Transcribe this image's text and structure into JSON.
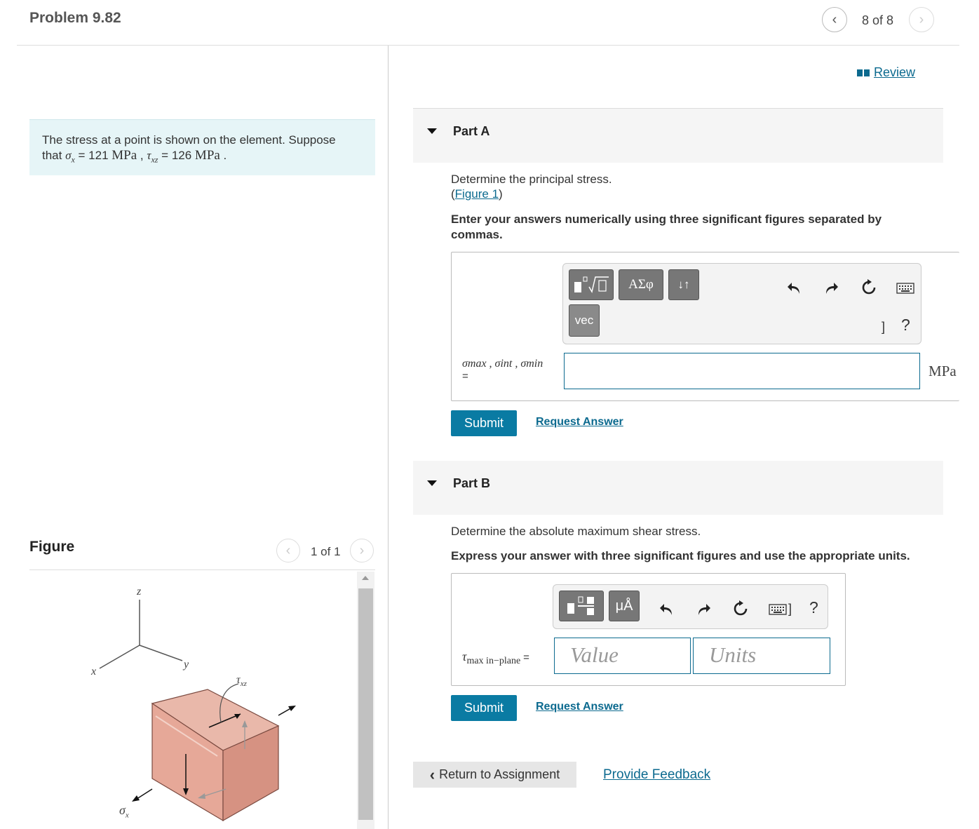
{
  "header": {
    "title": "Problem 9.82",
    "pager": "8 of 8",
    "review_label": "Review"
  },
  "problem": {
    "line1": "The stress at a point is shown on the element. Suppose",
    "that": "that",
    "sigma_x": "σ",
    "sigma_sub": "x",
    "eq1": " = 121 ",
    "unit1": "MPa",
    "comma": " , ",
    "tau": "τ",
    "tau_sub": "xz",
    "eq2": " = 126 ",
    "unit2": "MPa",
    "period": " ."
  },
  "figure": {
    "label": "Figure",
    "pager": "1 of 1",
    "axis_z": "z",
    "axis_y": "y",
    "axis_x": "x",
    "tau_label": "τ",
    "tau_sub": "xz",
    "sigma_label": "σ",
    "sigma_sub": "x"
  },
  "partA": {
    "label": "Part A",
    "question": "Determine the principal stress.",
    "figure_link_open": "(",
    "figure_link": "Figure 1",
    "figure_link_close": ")",
    "instruction_line1": "Enter your answers numerically using three significant figures separated by",
    "instruction_line2": "commas.",
    "toolbar_vec": "vec",
    "toolbar_greek": "ΑΣφ",
    "toolbar_arrows": "↓↑",
    "toolbar_bracket": "]",
    "toolbar_help": "?",
    "var_label": "σmax , σint , σmin",
    "equals": "=",
    "unit": "MPa",
    "submit": "Submit",
    "request": "Request Answer"
  },
  "partB": {
    "label": "Part B",
    "question": "Determine the absolute maximum shear stress.",
    "instruction": "Express your answer with three significant figures and use the appropriate units.",
    "toolbar_units": "μÅ",
    "toolbar_bracket": "]",
    "toolbar_help": "?",
    "var_symbol": "τ",
    "var_sub": "max in−plane",
    "equals": "=",
    "value_placeholder": "Value",
    "units_placeholder": "Units",
    "submit": "Submit",
    "request": "Request Answer"
  },
  "footer": {
    "return": "Return to Assignment",
    "feedback": "Provide Feedback"
  }
}
